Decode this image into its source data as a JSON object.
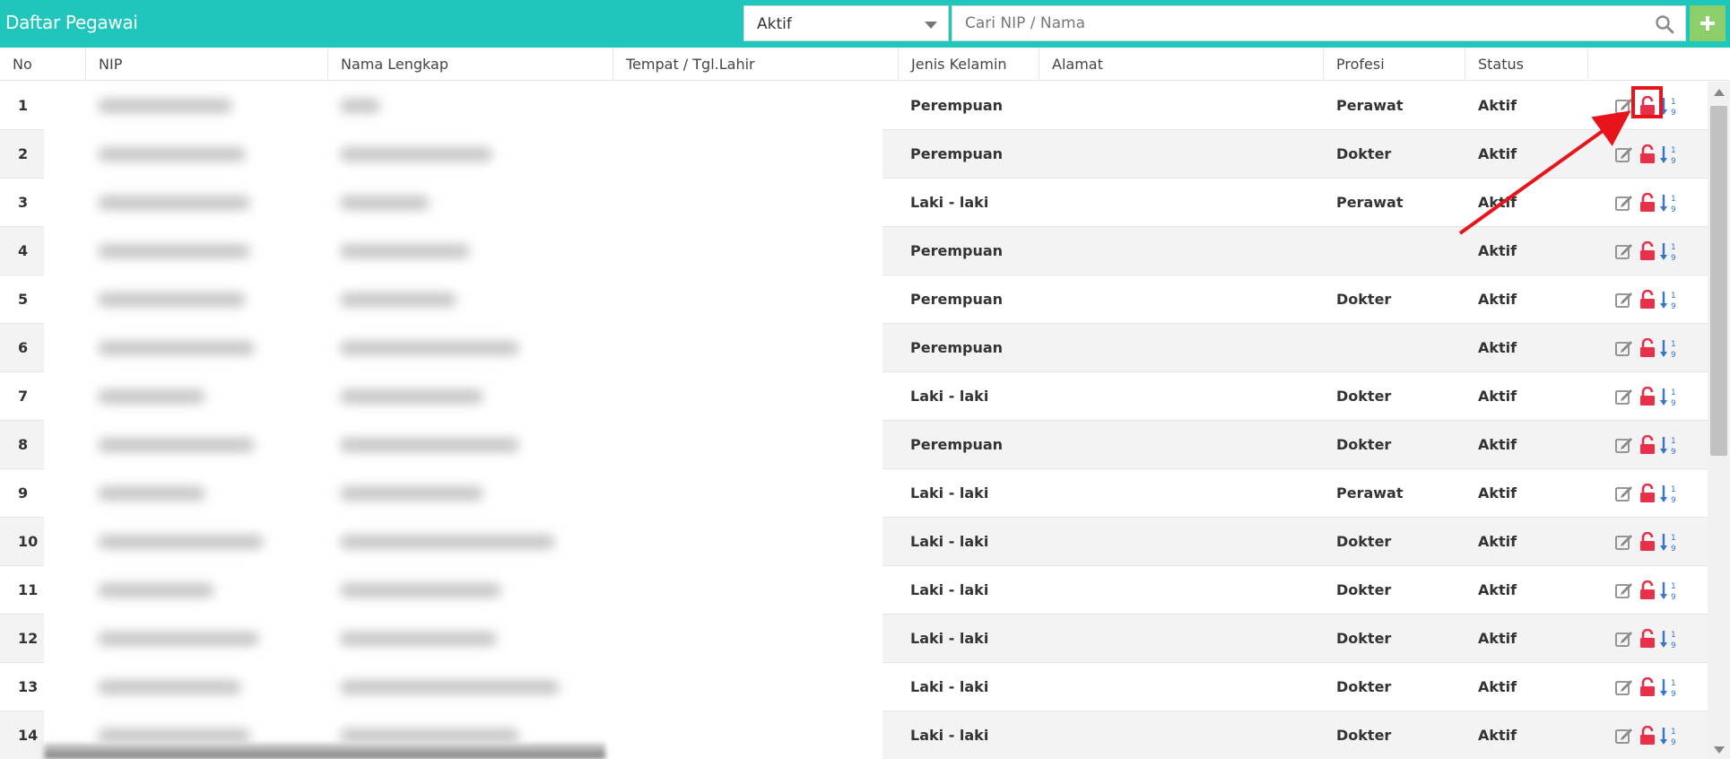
{
  "header": {
    "title": "Daftar Pegawai",
    "status_filter": "Aktif",
    "search_placeholder": "Cari NIP / Nama"
  },
  "columns": [
    "No",
    "NIP",
    "Nama Lengkap",
    "Tempat / Tgl.Lahir",
    "Jenis Kelamin",
    "Alamat",
    "Profesi",
    "Status"
  ],
  "rows": [
    {
      "no": "1",
      "jenis_kelamin": "Perempuan",
      "profesi": "Perawat",
      "status": "Aktif"
    },
    {
      "no": "2",
      "jenis_kelamin": "Perempuan",
      "profesi": "Dokter",
      "status": "Aktif"
    },
    {
      "no": "3",
      "jenis_kelamin": "Laki - laki",
      "profesi": "Perawat",
      "status": "Aktif"
    },
    {
      "no": "4",
      "jenis_kelamin": "Perempuan",
      "profesi": "",
      "status": "Aktif"
    },
    {
      "no": "5",
      "jenis_kelamin": "Perempuan",
      "profesi": "Dokter",
      "status": "Aktif"
    },
    {
      "no": "6",
      "jenis_kelamin": "Perempuan",
      "profesi": "",
      "status": "Aktif"
    },
    {
      "no": "7",
      "jenis_kelamin": "Laki - laki",
      "profesi": "Dokter",
      "status": "Aktif"
    },
    {
      "no": "8",
      "jenis_kelamin": "Perempuan",
      "profesi": "Dokter",
      "status": "Aktif"
    },
    {
      "no": "9",
      "jenis_kelamin": "Laki - laki",
      "profesi": "Perawat",
      "status": "Aktif"
    },
    {
      "no": "10",
      "jenis_kelamin": "Laki - laki",
      "profesi": "Dokter",
      "status": "Aktif"
    },
    {
      "no": "11",
      "jenis_kelamin": "Laki - laki",
      "profesi": "Dokter",
      "status": "Aktif"
    },
    {
      "no": "12",
      "jenis_kelamin": "Laki - laki",
      "profesi": "Dokter",
      "status": "Aktif"
    },
    {
      "no": "13",
      "jenis_kelamin": "Laki - laki",
      "profesi": "Dokter",
      "status": "Aktif"
    },
    {
      "no": "14",
      "jenis_kelamin": "Laki - laki",
      "profesi": "Dokter",
      "status": "Aktif"
    }
  ],
  "icons": {
    "edit": "edit-icon",
    "lock": "unlock-icon",
    "sort": "sort-numeric-icon",
    "search": "search-icon",
    "add": "plus-icon"
  },
  "colors": {
    "header": "#1fc6bb",
    "add_button": "#8ccf6a",
    "lock": "#e8304a",
    "sort": "#3a74c9",
    "annotation": "#e8141c"
  }
}
